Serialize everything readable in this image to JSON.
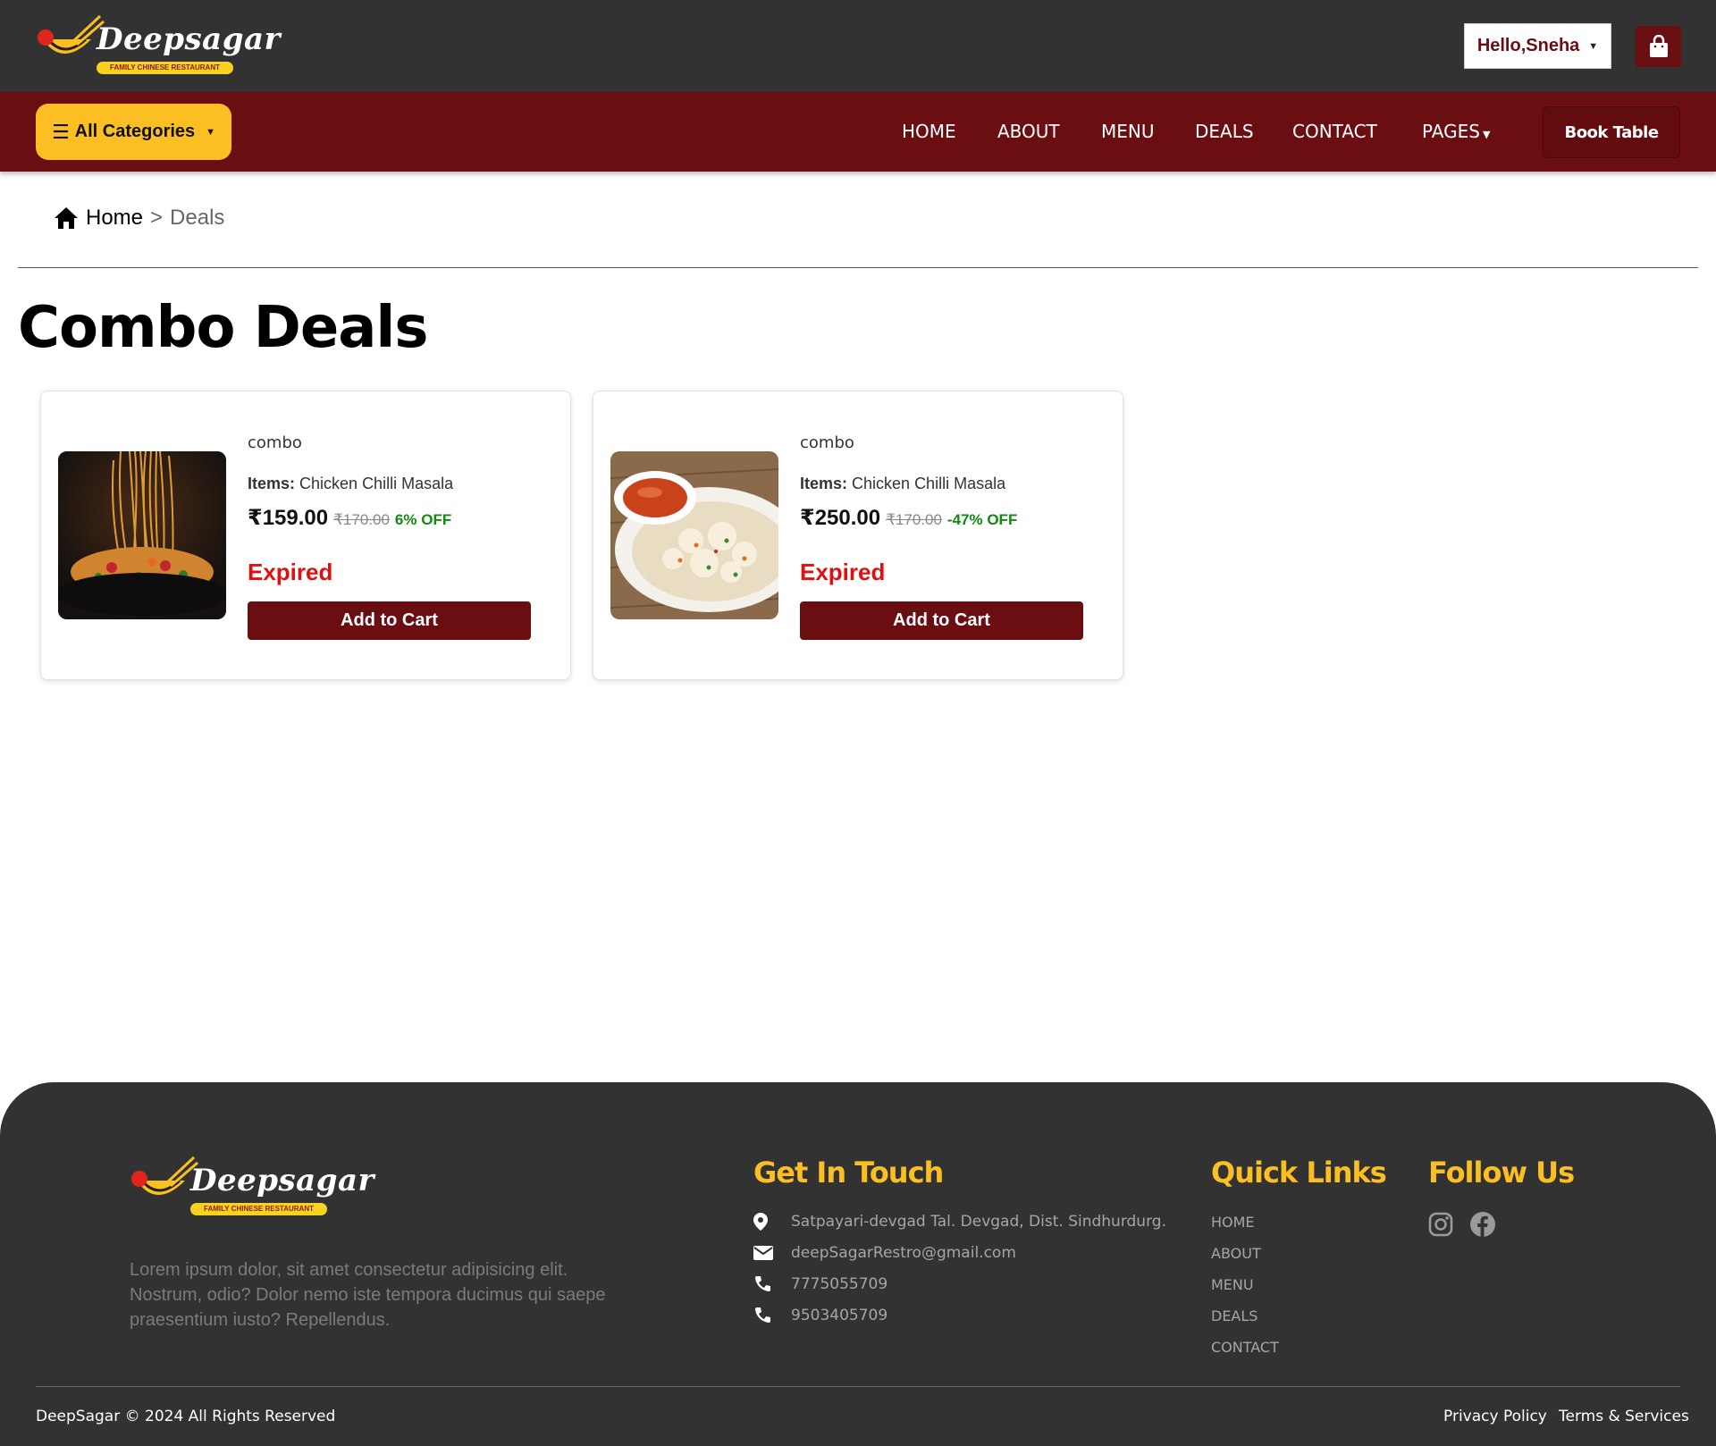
{
  "brand": {
    "name": "Deepsagar",
    "tagline": "FAMILY CHINESE RESTAURANT"
  },
  "header": {
    "user_greeting": "Hello,Sneha",
    "cart_icon": "shopping-bag-icon"
  },
  "nav": {
    "categories_label": "All Categories",
    "links": [
      "HOME",
      "ABOUT",
      "MENU",
      "DEALS",
      "CONTACT",
      "PAGES"
    ],
    "book_table_label": "Book Table"
  },
  "breadcrumb": {
    "home": "Home",
    "separator": ">",
    "current": "Deals"
  },
  "page": {
    "title": "Combo Deals"
  },
  "deals": [
    {
      "kind": "combo",
      "items_label": "Items:",
      "items": "Chicken Chilli Masala",
      "price": "₹159.00",
      "mrp": "₹170.00",
      "discount": "6% OFF",
      "status": "Expired",
      "button": "Add to Cart",
      "image": "noodles-photo"
    },
    {
      "kind": "combo",
      "items_label": "Items:",
      "items": "Chicken Chilli Masala",
      "price": "₹250.00",
      "mrp": "₹170.00",
      "discount": "-47% OFF",
      "status": "Expired",
      "button": "Add to Cart",
      "image": "fried-rice-photo"
    }
  ],
  "footer": {
    "about": "Lorem ipsum dolor, sit amet consectetur adipisicing elit. Nostrum, odio? Dolor nemo iste tempora ducimus qui saepe praesentium iusto? Repellendus.",
    "get_in_touch": {
      "heading": "Get In Touch",
      "address": "Satpayari-devgad Tal. Devgad, Dist. Sindhurdurg.",
      "email": "deepSagarRestro@gmail.com",
      "phone1": "7775055709",
      "phone2": "9503405709"
    },
    "quick_links": {
      "heading": "Quick Links",
      "links": [
        "HOME",
        "ABOUT",
        "MENU",
        "DEALS",
        "CONTACT"
      ]
    },
    "follow_us": {
      "heading": "Follow Us",
      "icons": [
        "instagram-icon",
        "facebook-icon"
      ]
    },
    "copyright": "DeepSagar © 2024 All Rights Reserved",
    "privacy": "Privacy Policy",
    "terms": "Terms & Services"
  },
  "colors": {
    "topbar": "#323232",
    "navbar": "#6a0e12",
    "accent_yellow": "#fbbf24",
    "expired_red": "#e01010",
    "discount_green": "#118a11"
  }
}
